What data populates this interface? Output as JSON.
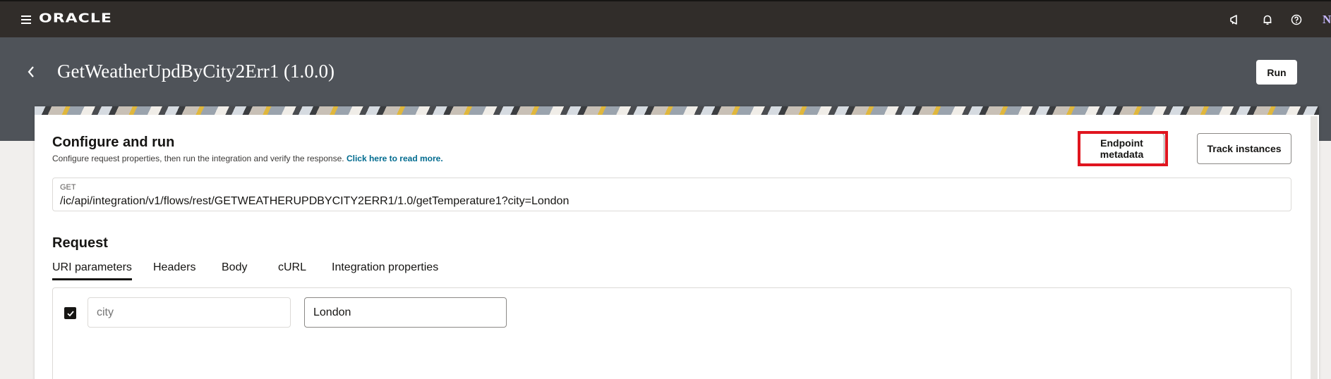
{
  "app": {
    "logo_text": "ORACLE",
    "avatar_initial": "N"
  },
  "header": {
    "title": "GetWeatherUpdByCity2Err1 (1.0.0)",
    "run_label": "Run"
  },
  "configure": {
    "title": "Configure and run",
    "description": "Configure request properties, then run the integration and verify the response.",
    "read_more_link": "Click here to read more.",
    "endpoint_metadata_label": "Endpoint metadata",
    "track_instances_label": "Track instances",
    "highlight_color": "#e0151f"
  },
  "endpoint": {
    "method": "GET",
    "path": "/ic/api/integration/v1/flows/rest/GETWEATHERUPDBYCITY2ERR1/1.0/getTemperature1?city=London"
  },
  "request": {
    "title": "Request",
    "tabs": [
      {
        "label": "URI parameters",
        "active": true
      },
      {
        "label": "Headers",
        "active": false
      },
      {
        "label": "Body",
        "active": false
      },
      {
        "label": "cURL",
        "active": false
      },
      {
        "label": "Integration properties",
        "active": false
      }
    ],
    "params": [
      {
        "checked": true,
        "name_placeholder": "city",
        "value": "London"
      }
    ]
  },
  "icons": {
    "menu": "hamburger-icon",
    "announcements": "megaphone-icon",
    "notifications": "bell-icon",
    "help": "help-icon",
    "back": "chevron-left-icon",
    "check": "check-icon"
  }
}
